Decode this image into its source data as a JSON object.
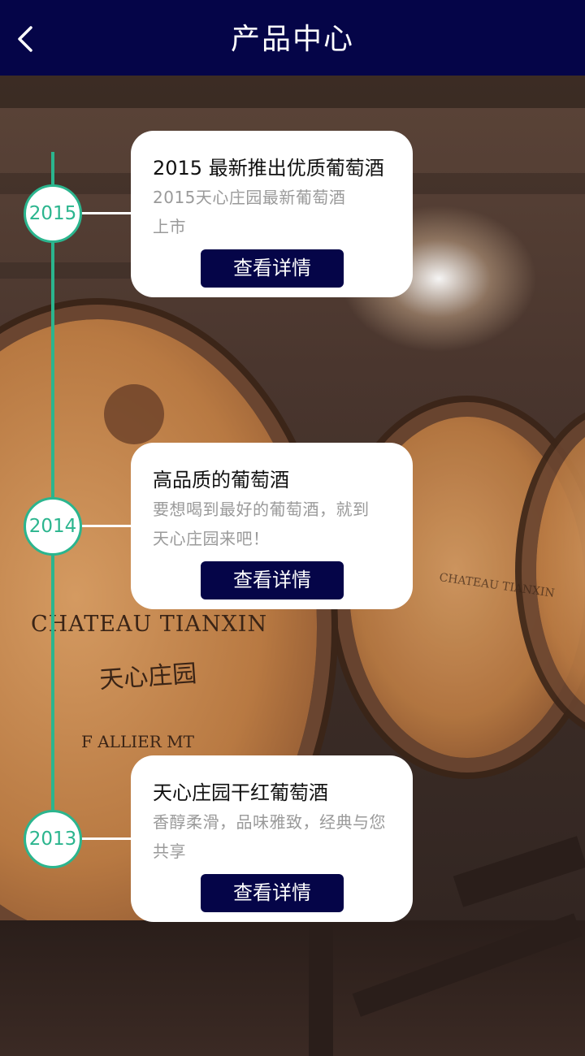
{
  "header": {
    "title": "产品中心",
    "back_icon": "chevron-left-icon"
  },
  "background": {
    "description_colors": {
      "wood": "#b87942",
      "cellar": "#3b2c26"
    },
    "barrel_text": {
      "brand": "CHATEAU TIANXIN",
      "chinese": "天心庄园",
      "lower": "F ALLIER MT"
    }
  },
  "timeline": {
    "accent_color": "#2bb58e",
    "items": [
      {
        "year": "2015",
        "title": "2015 最新推出优质葡萄酒",
        "desc_line1": "2015天心庄园最新葡萄酒",
        "desc_line2": "上市",
        "button": "查看详情"
      },
      {
        "year": "2014",
        "title": "高品质的葡萄酒",
        "desc_line1": "要想喝到最好的葡萄酒，就到",
        "desc_line2": "天心庄园来吧！",
        "button": "查看详情"
      },
      {
        "year": "2013",
        "title": "天心庄园干红葡萄酒",
        "desc_line1": "香醇柔滑，品味雅致，经典与您",
        "desc_line2": "共享",
        "button": "查看详情"
      }
    ]
  },
  "colors": {
    "header_bg": "#050548",
    "button_bg": "#050548",
    "card_bg": "#ffffff"
  }
}
